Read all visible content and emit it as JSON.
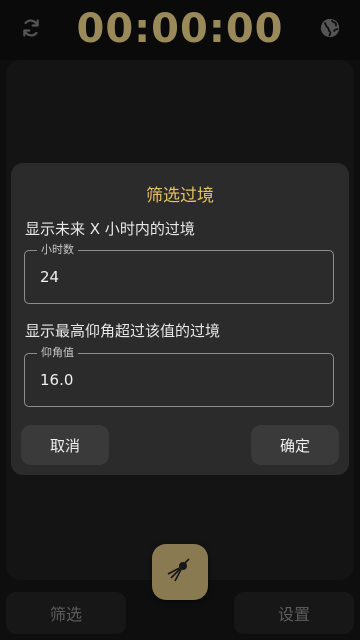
{
  "header": {
    "clock": "00:00:00",
    "refresh_icon": "refresh-icon",
    "globe_icon": "globe-icon"
  },
  "dialog": {
    "title": "筛选过境",
    "hours_label": "显示未来 X 小时内的过境",
    "hours_field": {
      "legend": "小时数",
      "value": "24"
    },
    "elevation_label": "显示最高仰角超过该值的过境",
    "elevation_field": {
      "legend": "仰角值",
      "value": "16.0"
    },
    "cancel_label": "取消",
    "ok_label": "确定"
  },
  "bottom_bar": {
    "filter_label": "筛选",
    "settings_label": "设置",
    "fab_icon": "satellite-icon"
  },
  "colors": {
    "accent": "#e3c35e",
    "clock": "#9a8a5a",
    "fab": "#8a7a52",
    "dialog_bg": "#2b2b2b"
  }
}
